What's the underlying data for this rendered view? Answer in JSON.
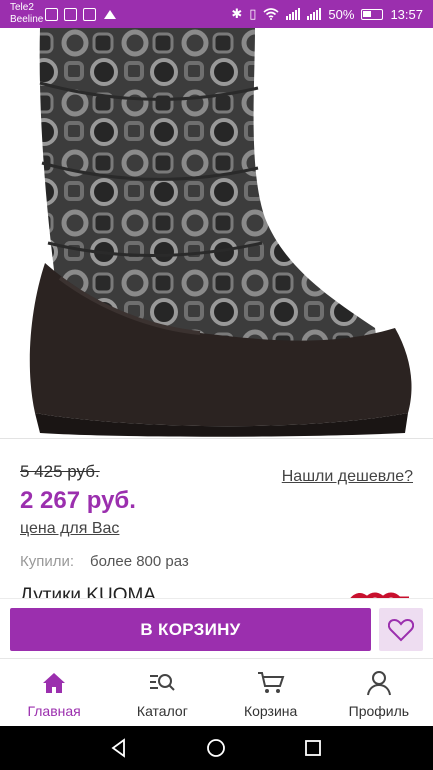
{
  "status_bar": {
    "carrier1": "Tele2",
    "carrier2": "Beeline",
    "battery": "50%",
    "time": "13:57"
  },
  "product": {
    "image_icon": "winter-boot-image",
    "old_price": "5 425 руб.",
    "price": "2 267 руб.",
    "price_note": "цена для Вас",
    "cheaper_link": "Нашли дешевле?",
    "bought_label": "Купили:",
    "bought_value": "более 800 раз",
    "name": "Дутики KUOMA",
    "brand_logo": "kuoma-logo"
  },
  "actions": {
    "add_to_cart": "В КОРЗИНУ",
    "favorite_icon": "heart-icon"
  },
  "bottom_nav": {
    "items": [
      {
        "label": "Главная",
        "icon": "home-icon",
        "active": true
      },
      {
        "label": "Каталог",
        "icon": "catalog-search-icon",
        "active": false
      },
      {
        "label": "Корзина",
        "icon": "cart-icon",
        "active": false
      },
      {
        "label": "Профиль",
        "icon": "profile-icon",
        "active": false
      }
    ]
  },
  "colors": {
    "accent": "#9b2fae",
    "accent_light": "#eeddf1",
    "text": "#222222",
    "muted": "#999999"
  }
}
